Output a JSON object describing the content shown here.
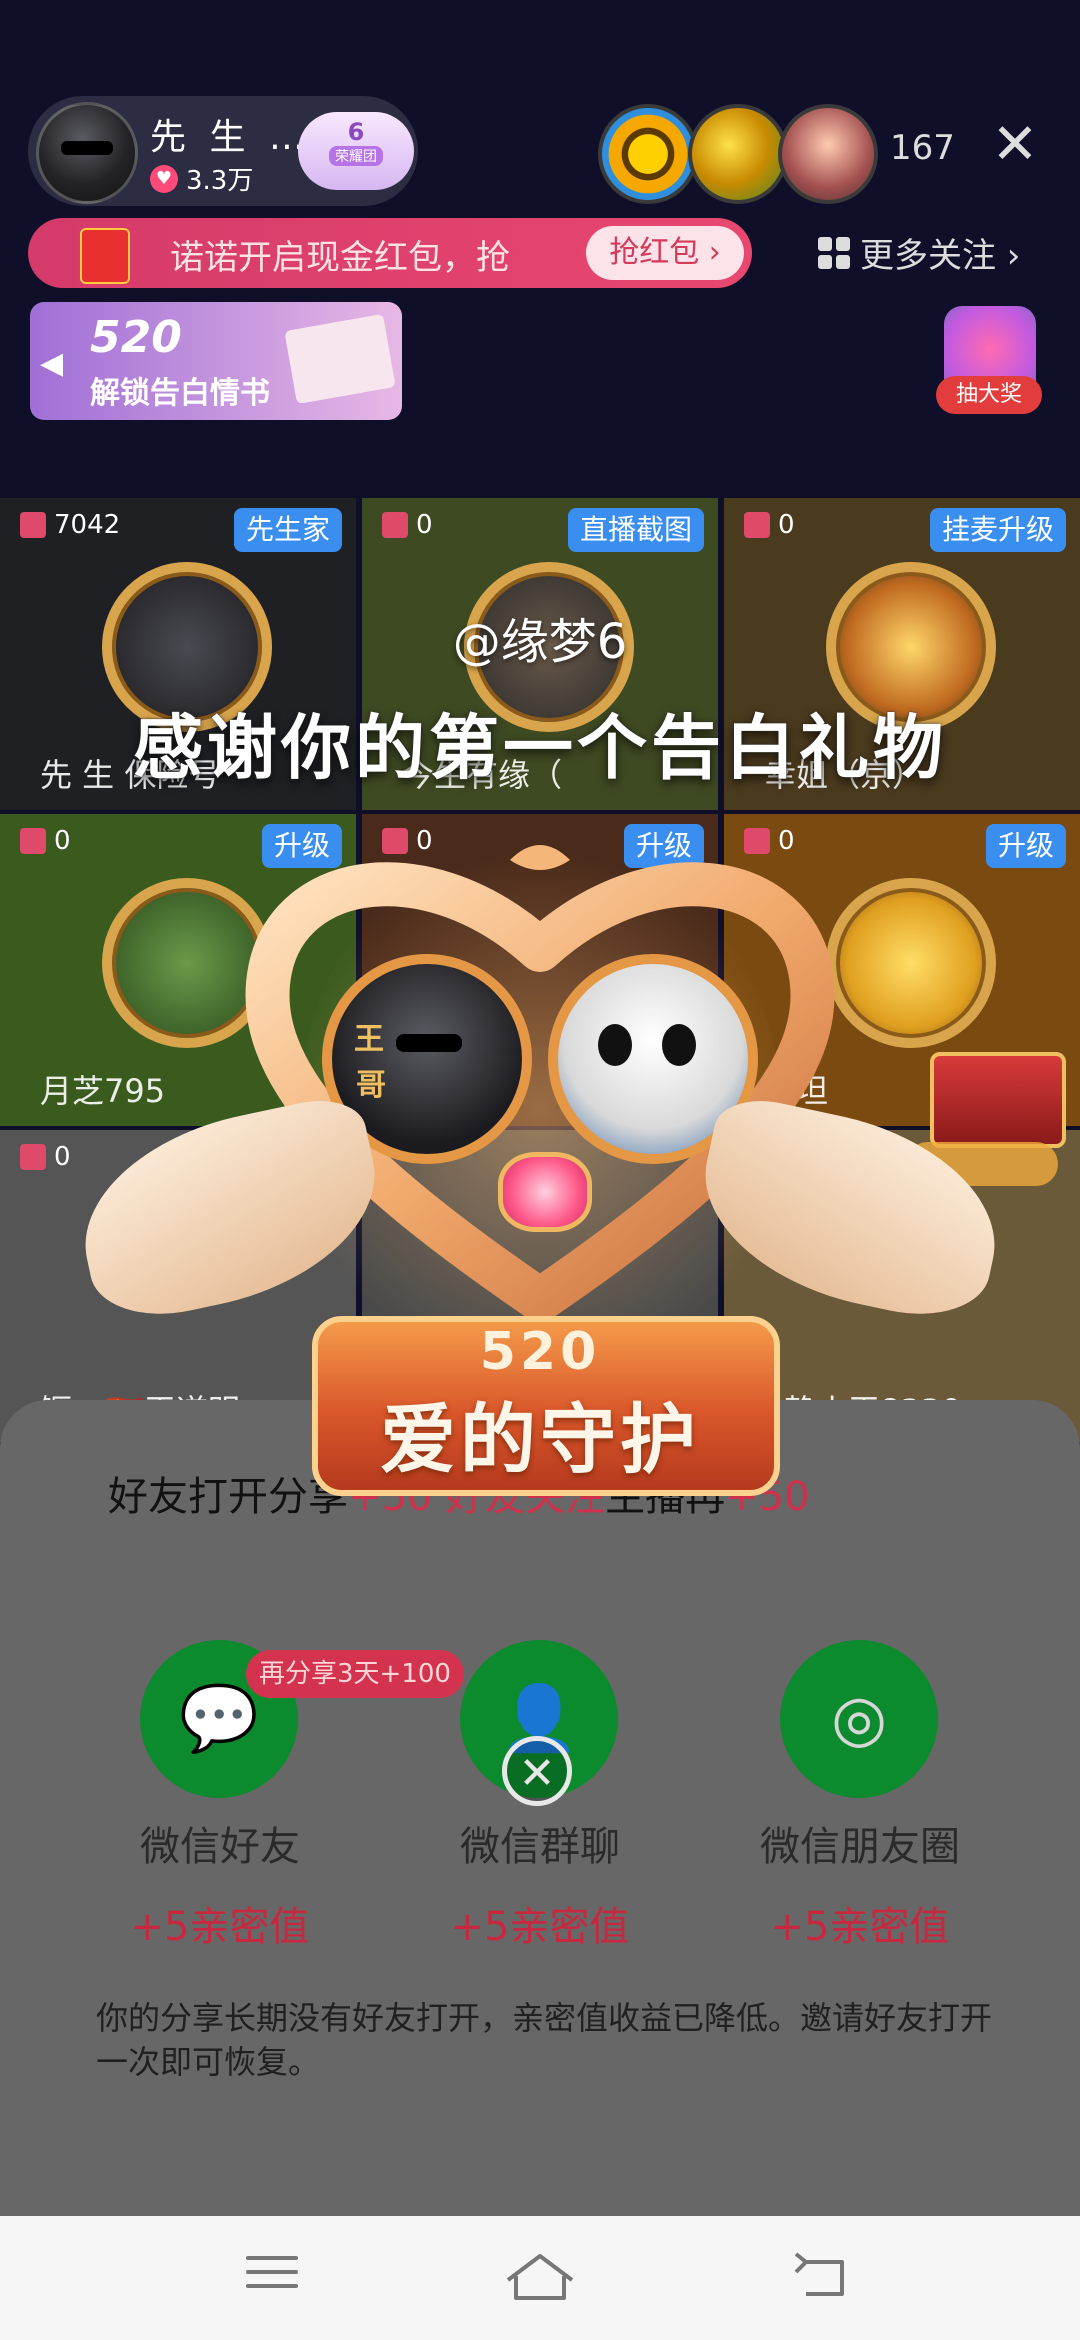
{
  "top_bar": {
    "host_name": "先 生 …",
    "host_likes": "3.3万",
    "fan_badge_level": "6",
    "fan_badge_label": "荣耀团",
    "viewer_count": "167"
  },
  "red_packet_banner": {
    "icon_label": "现金",
    "text": "诺诺开启现金红包，抢",
    "button_label": "抢红包 ›"
  },
  "more_follow_label": "更多关注 ›",
  "confession_card": {
    "number": "520",
    "text": "解锁告白情书"
  },
  "lottery_label": "抽大奖",
  "seats": [
    {
      "gift_count": "7042",
      "tag": "先生家",
      "name": "先 生 保险号"
    },
    {
      "gift_count": "0",
      "tag": "直播截图",
      "name": "今生有缘（"
    },
    {
      "gift_count": "0",
      "tag": "挂麦升级",
      "name": "幸姐（京）"
    },
    {
      "gift_count": "0",
      "tag": "升级",
      "name": "月芝795"
    },
    {
      "gift_count": "0",
      "tag": "升级",
      "name": ""
    },
    {
      "gift_count": "0",
      "tag": "升级",
      "name": "诚坦"
    },
    {
      "gift_count": "0",
      "tag": "",
      "name": "鳜…🇨🇳王道明"
    },
    {
      "gift_count": "",
      "tag": "",
      "name": ""
    },
    {
      "gift_count": "",
      "tag": "",
      "name": "静小王8330"
    }
  ],
  "gift_overlay": {
    "username": "@缘梦6",
    "title": "感谢你的第一个告白礼物",
    "gift_number": "520",
    "gift_name": "爱的守护"
  },
  "share_sheet": {
    "title_prefix": "好友打开分享",
    "title_hidden": "+50 好友关注",
    "title_suffix": "主播再",
    "title_bonus": "+50",
    "promo_badge": "再分享3天+100",
    "options": [
      {
        "label": "微信好友",
        "bonus": "+5亲密值",
        "icon": "wechat-icon"
      },
      {
        "label": "微信群聊",
        "bonus": "+5亲密值",
        "icon": "group-chat-icon"
      },
      {
        "label": "微信朋友圈",
        "bonus": "+5亲密值",
        "icon": "moments-icon"
      }
    ],
    "notice": "你的分享长期没有好友打开，亲密值收益已降低。邀请好友打开一次即可恢复。"
  },
  "colors": {
    "accent_red": "#d0304c",
    "wechat_green": "#0c8a2e",
    "tag_blue": "#3a8ef0"
  }
}
